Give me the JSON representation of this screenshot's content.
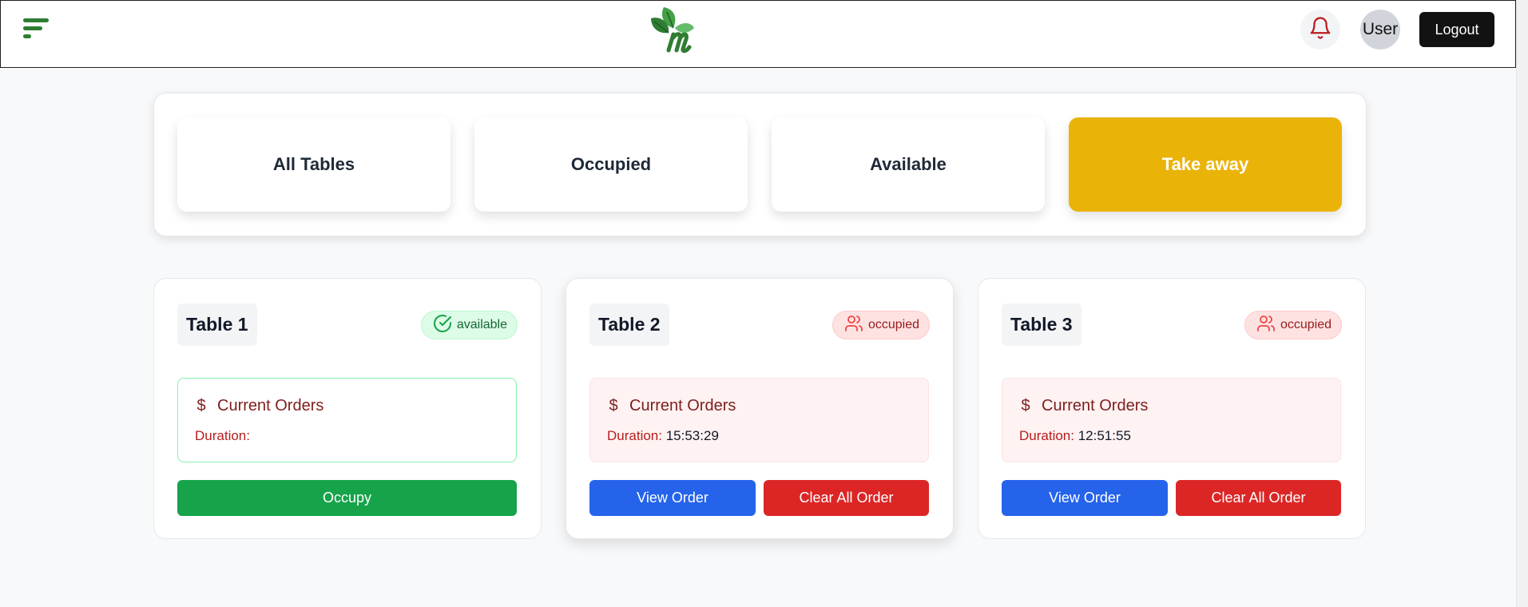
{
  "header": {
    "user_label": "User",
    "logout_label": "Logout",
    "brand_color": "#2e7d32"
  },
  "filters": [
    {
      "label": "All Tables",
      "active": false
    },
    {
      "label": "Occupied",
      "active": false
    },
    {
      "label": "Available",
      "active": false
    },
    {
      "label": "Take away",
      "active": true,
      "color": "#eab308"
    }
  ],
  "tables": [
    {
      "name": "Table 1",
      "status": "available",
      "orders_title": "Current Orders",
      "duration_label": "Duration:",
      "duration_value": "",
      "occupy_label": "Occupy"
    },
    {
      "name": "Table 2",
      "status": "occupied",
      "orders_title": "Current Orders",
      "duration_label": "Duration:",
      "duration_value": "15:53:29",
      "view_label": "View Order",
      "clear_label": "Clear All Order"
    },
    {
      "name": "Table 3",
      "status": "occupied",
      "orders_title": "Current Orders",
      "duration_label": "Duration:",
      "duration_value": "12:51:55",
      "view_label": "View Order",
      "clear_label": "Clear All Order"
    }
  ],
  "icons": {
    "menu": "menu-icon",
    "logo": "leaf-m-logo",
    "bell": "bell-icon",
    "available": "check-circle-icon",
    "occupied": "users-icon",
    "orders": "dollar-icon"
  },
  "colors": {
    "available": "#16a34a",
    "occupied": "#dc2626",
    "view": "#2563eb"
  }
}
